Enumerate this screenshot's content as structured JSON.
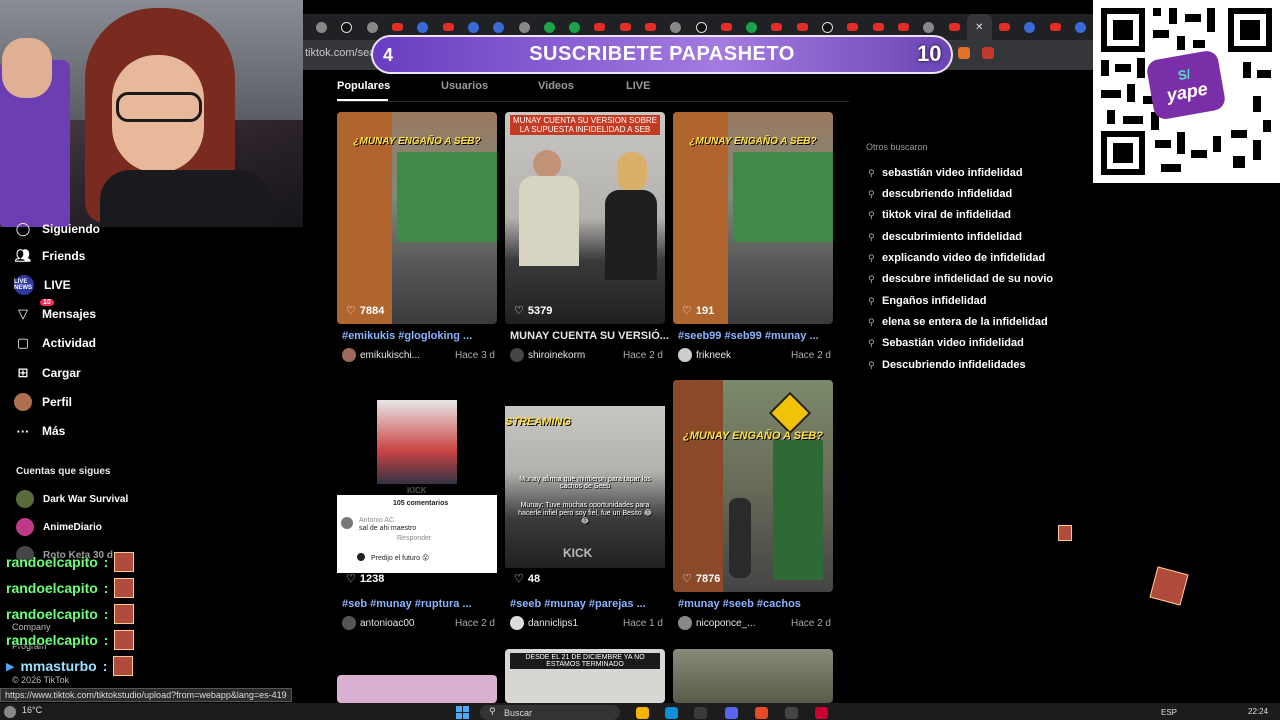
{
  "browser": {
    "url": "tiktok.com/sear",
    "status_url": "https://www.tiktok.com/tiktokstudio/upload?from=webapp&lang=es-419"
  },
  "banner": {
    "left_number": "4",
    "text": "SUSCRIBETE PAPASHETO",
    "right_number": "10"
  },
  "tabs": [
    {
      "label": "Populares",
      "active": true
    },
    {
      "label": "Usuarios",
      "active": false
    },
    {
      "label": "Videos",
      "active": false
    },
    {
      "label": "LIVE",
      "active": false
    }
  ],
  "sidebar": {
    "partial_item": "Siguiendo",
    "items": [
      {
        "label": "Friends",
        "icon": "friends-icon"
      },
      {
        "label": "LIVE",
        "icon": "live-icon",
        "icon_text": "LIVE NEWS"
      },
      {
        "label": "Mensajes",
        "icon": "messages-icon",
        "badge": "10"
      },
      {
        "label": "Actividad",
        "icon": "activity-icon"
      },
      {
        "label": "Cargar",
        "icon": "upload-icon"
      },
      {
        "label": "Perfil",
        "icon": "profile-avatar"
      },
      {
        "label": "Más",
        "icon": "more-icon"
      }
    ],
    "following_label": "Cuentas que sigues",
    "following": [
      {
        "name": "Dark War Survival"
      },
      {
        "name": "AnimeDiario"
      },
      {
        "name": "Roto Keta 30 d"
      }
    ],
    "footer_company": "Company",
    "footer_program": "Program",
    "copyright": "© 2026 TikTok"
  },
  "chat": [
    {
      "user": "randoelcapito",
      "sep": ":"
    },
    {
      "user": "randoelcapito",
      "sep": ":"
    },
    {
      "user": "randoelcapito",
      "sep": ":"
    },
    {
      "user": "randoelcapito",
      "sep": ":"
    },
    {
      "user": "mmasturbo",
      "sep": ":"
    }
  ],
  "videos": [
    {
      "likes": "7884",
      "desc": "#emikukis #glogloking ...",
      "author": "emikukischi...",
      "time": "Hace 3 d",
      "caption": "¿MUNAY ENGAÑO A SEB?"
    },
    {
      "likes": "5379",
      "desc": "MUNAY CUENTA SU VERSIÓ...",
      "author": "shiroinekorm",
      "time": "Hace 2 d",
      "caption": "MUNAY CUENTA SU VERSION SOBRE LA SUPUESTA INFIDELIDAD A SEB"
    },
    {
      "likes": "191",
      "desc": "#seeb99 #seb99 #munay ...",
      "author": "frikneek",
      "time": "Hace 2 d",
      "caption": "¿MUNAY ENGAÑO A SEB?"
    },
    {
      "likes": "1238",
      "desc": "#seb #munay #ruptura ...",
      "author": "antonioac00",
      "time": "Hace 2 d",
      "caption": "105 comentarios"
    },
    {
      "likes": "48",
      "desc": "#seeb #munay #parejas ...",
      "author": "danniclips1",
      "time": "Hace 1 d",
      "caption": "STREAMING"
    },
    {
      "likes": "7876",
      "desc": "#munay #seeb #cachos",
      "author": "nicoponce_...",
      "time": "Hace 2 d",
      "caption": "¿MUNAY ENGAÑO A SEB?"
    }
  ],
  "video_extra": {
    "kick": "KICK",
    "comment_user": "Antonio AC",
    "comment_text": "sal de ahi maestro",
    "comment_reply": "Responder",
    "comment_text2": "Predijo el futuro 😮",
    "streaming_sub": "Munay afirma que mintieron para tapar los cachos de Seeb",
    "streaming_sub2": "Munay: Tuve muchas oportunidades para hacerle infiel pero soy fiel, fue un Besito 😂😂",
    "row3_caption": "DESDE EL 21 DE DICIEMBRE YA NO ESTAMOS TERMINADO"
  },
  "others": {
    "label": "Otros buscaron",
    "items": [
      "sebastián video infidelidad",
      "descubriendo infidelidad",
      "tiktok viral de infidelidad",
      "descubrimiento infidelidad",
      "explicando video de infidelidad",
      "descubre infidelidad de su novio",
      "Engaños infidelidad",
      "elena se entera de la infidelidad",
      "Sebastián video infidelidad",
      "Descubriendo infidelidades"
    ]
  },
  "qr": {
    "logo_symbol": "S/",
    "logo_text": "yape"
  },
  "taskbar": {
    "temperature": "16°C",
    "search": "Buscar",
    "lang": "ESP",
    "time": "22:24"
  },
  "colors": {
    "accent": "#fe2c55",
    "hashtag": "#8bb4ff",
    "chat_name": "#6bff7a",
    "banner": "#a47be0"
  }
}
